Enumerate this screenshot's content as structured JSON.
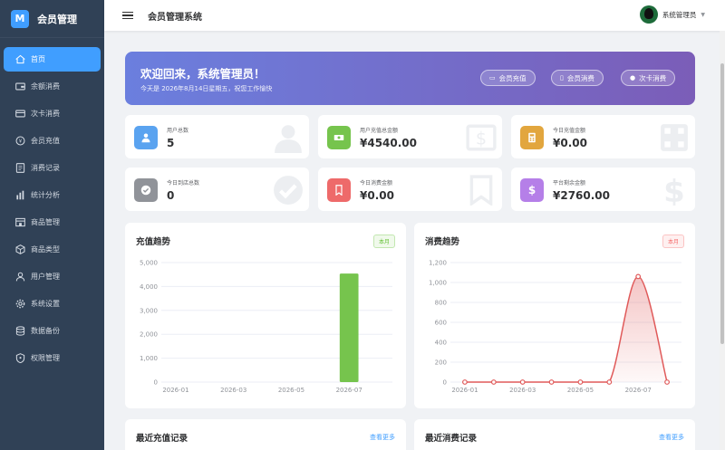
{
  "brand": {
    "logo": "M",
    "title": "会员管理"
  },
  "sidebar": {
    "items": [
      {
        "label": "首页",
        "icon": "home-icon",
        "active": true
      },
      {
        "label": "余额消费",
        "icon": "wallet-icon"
      },
      {
        "label": "次卡消费",
        "icon": "card-icon"
      },
      {
        "label": "会员充值",
        "icon": "recharge-icon"
      },
      {
        "label": "消费记录",
        "icon": "records-icon"
      },
      {
        "label": "统计分析",
        "icon": "bar-chart-icon"
      },
      {
        "label": "商品管理",
        "icon": "shop-icon"
      },
      {
        "label": "商品类型",
        "icon": "box-icon"
      },
      {
        "label": "用户管理",
        "icon": "user-icon"
      },
      {
        "label": "系统设置",
        "icon": "gear-icon"
      },
      {
        "label": "数据备份",
        "icon": "database-icon"
      },
      {
        "label": "权限管理",
        "icon": "shield-icon"
      }
    ]
  },
  "header": {
    "title": "会员管理系统",
    "user_name": "系统管理员"
  },
  "banner": {
    "welcome": "欢迎回来，系统管理员！",
    "subtitle": "今天是 2026年8月14日星期五，祝您工作愉快",
    "buttons": [
      {
        "label": "会员充值",
        "icon": "card-icon"
      },
      {
        "label": "会员消费",
        "icon": "bookmark-icon"
      },
      {
        "label": "次卡消费",
        "icon": "info-icon"
      }
    ]
  },
  "stats": [
    {
      "label": "用户总数",
      "value": "5",
      "color": "#5aa3f0",
      "icon": "user-icon"
    },
    {
      "label": "用户充值总金额",
      "value": "¥4540.00",
      "color": "#76c44d",
      "icon": "money-icon"
    },
    {
      "label": "今日充值金额",
      "value": "¥0.00",
      "color": "#e2a63e",
      "icon": "calculator-icon"
    },
    {
      "label": "今日到店总数",
      "value": "0",
      "color": "#909399",
      "icon": "check-icon"
    },
    {
      "label": "今日消费金额",
      "value": "¥0.00",
      "color": "#ee6a6a",
      "icon": "bookmark-icon"
    },
    {
      "label": "平台剩余金额",
      "value": "¥2760.00",
      "color": "#b57fe8",
      "icon": "dollar-icon"
    }
  ],
  "charts": {
    "recharge": {
      "title": "充值趋势",
      "tag": "本月"
    },
    "consume": {
      "title": "消费趋势",
      "tag": "本月"
    }
  },
  "records": {
    "recharge_title": "最近充值记录",
    "consume_title": "最近消费记录",
    "more_label": "查看更多"
  },
  "chart_data": [
    {
      "type": "bar",
      "title": "充值趋势",
      "categories": [
        "2026-01",
        "2026-02",
        "2026-03",
        "2026-04",
        "2026-05",
        "2026-06",
        "2026-07",
        "2026-08"
      ],
      "x_tick_labels": [
        "2026-01",
        "2026-03",
        "2026-05",
        "2026-07"
      ],
      "values": [
        0,
        0,
        0,
        0,
        0,
        0,
        4540,
        0
      ],
      "ylim": [
        0,
        5000
      ],
      "y_ticks": [
        "0",
        "1,000",
        "2,000",
        "3,000",
        "4,000",
        "5,000"
      ],
      "grid": true,
      "color": "#76c44d"
    },
    {
      "type": "line",
      "title": "消费趋势",
      "categories": [
        "2026-01",
        "2026-02",
        "2026-03",
        "2026-04",
        "2026-05",
        "2026-06",
        "2026-07",
        "2026-08"
      ],
      "x_tick_labels": [
        "2026-01",
        "2026-03",
        "2026-05",
        "2026-07"
      ],
      "values": [
        0,
        0,
        0,
        0,
        0,
        0,
        1060,
        0
      ],
      "ylim": [
        0,
        1200
      ],
      "y_ticks": [
        "0",
        "200",
        "400",
        "600",
        "800",
        "1,000",
        "1,200"
      ],
      "grid": true,
      "smooth": true,
      "color": "#e05a5a"
    }
  ]
}
